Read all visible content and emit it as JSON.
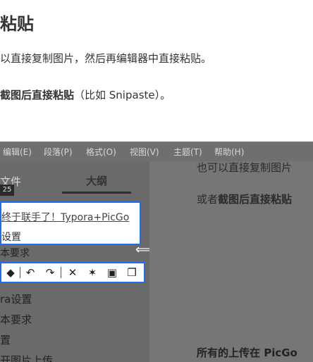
{
  "doc": {
    "heading": "粘贴",
    "para1": "以直接复制图片，然后再编辑器中直接粘贴。",
    "para2_bold": "截图后直接粘贴",
    "para2_rest": "（比如 Snipaste）。"
  },
  "screenshot": {
    "menu": [
      "编辑(E)",
      "段落(P)",
      "格式(O)",
      "视图(V)",
      "主题(T)",
      "帮助(H)"
    ],
    "tabs": {
      "files": "文件",
      "outline": "大纲"
    },
    "badge": "25",
    "popup": {
      "link": "终于联手了！Typora+PicGo",
      "line2": "设置"
    },
    "under_text": "本要求",
    "toolbar_icons": [
      "eraser-icon",
      "undo-icon",
      "redo-icon",
      "close-icon",
      "pin-icon",
      "save-icon",
      "copy-icon"
    ],
    "sidebar_items": [
      "ra设置",
      "本要求",
      "置",
      "开图片上传"
    ],
    "editor": {
      "line1": "也可以直接复制图片",
      "line2_prefix": "或者",
      "line2_bold": "截图后直接粘贴",
      "line3": "所有的上传在 PicGo"
    }
  }
}
